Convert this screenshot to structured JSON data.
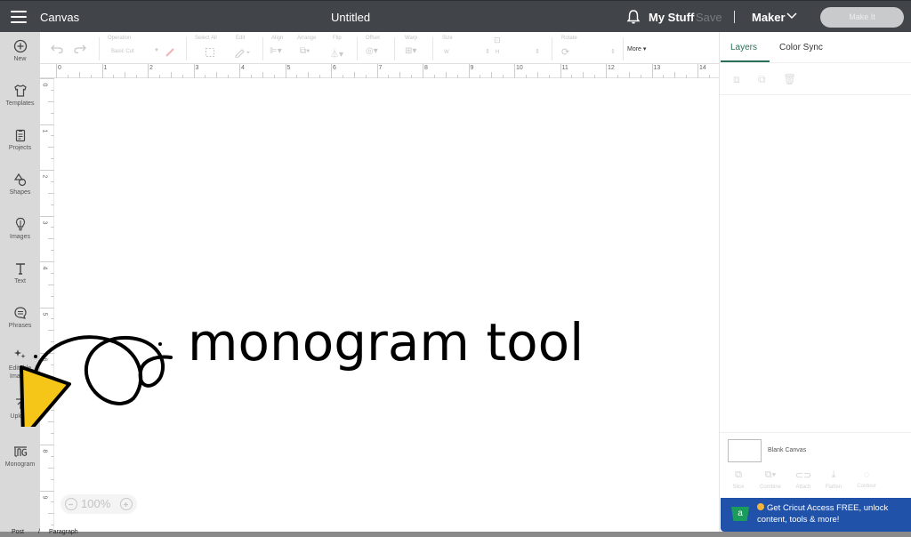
{
  "topbar": {
    "app_name": "Canvas",
    "doc_title": "Untitled",
    "my_stuff": "My Stuff",
    "save": "Save",
    "machine": "Maker",
    "make_it": "Make It"
  },
  "sidebar": {
    "items": [
      {
        "label": "New",
        "icon": "plus-circle-icon"
      },
      {
        "label": "Templates",
        "icon": "shirt-icon"
      },
      {
        "label": "Projects",
        "icon": "clipboard-icon"
      },
      {
        "label": "Shapes",
        "icon": "shapes-icon"
      },
      {
        "label": "Images",
        "icon": "lightbulb-icon"
      },
      {
        "label": "Text",
        "icon": "text-icon"
      },
      {
        "label": "Phrases",
        "icon": "speech-bubble-icon"
      },
      {
        "label": "Editable Images",
        "icon": "sparkle-icon"
      },
      {
        "label": "Upload",
        "icon": "upload-icon"
      },
      {
        "label": "Monogram",
        "icon": "monogram-icon"
      }
    ]
  },
  "toolbar": {
    "operation_label": "Operation",
    "operation_value": "Basic Cut",
    "select_all": "Select All",
    "edit": "Edit",
    "align": "Align",
    "arrange": "Arrange",
    "flip": "Flip",
    "offset": "Offset",
    "warp": "Warp",
    "size": "Size",
    "size_w": "W",
    "size_h": "H",
    "rotate": "Rotate",
    "more": "More ▾"
  },
  "ruler": {
    "top": [
      "0",
      "1",
      "2",
      "3",
      "4",
      "5",
      "6",
      "7",
      "8",
      "9",
      "10",
      "11",
      "12",
      "13",
      "14"
    ],
    "left": [
      "0",
      "1",
      "2",
      "3",
      "4",
      "5",
      "6",
      "7",
      "8",
      "9"
    ]
  },
  "canvas": {
    "zoom_level": "100%"
  },
  "overlay": {
    "headline": "monogram tool",
    "accent_color": "#f5c518"
  },
  "right_panel": {
    "tabs": [
      {
        "label": "Layers",
        "active": true
      },
      {
        "label": "Color Sync",
        "active": false
      }
    ],
    "blank_canvas_label": "Blank Canvas",
    "bottom_tools": [
      "Slice",
      "Combine",
      "Attach",
      "Flatten",
      "Contour"
    ],
    "promo_text_line1": "Get Cricut Access FREE, unlock",
    "promo_text_line2": "content, tools & more!",
    "promo_badge": "a",
    "promo_color": "#2152a9"
  },
  "footer": {
    "crumbs": [
      "Post",
      "/",
      "Paragraph"
    ]
  }
}
